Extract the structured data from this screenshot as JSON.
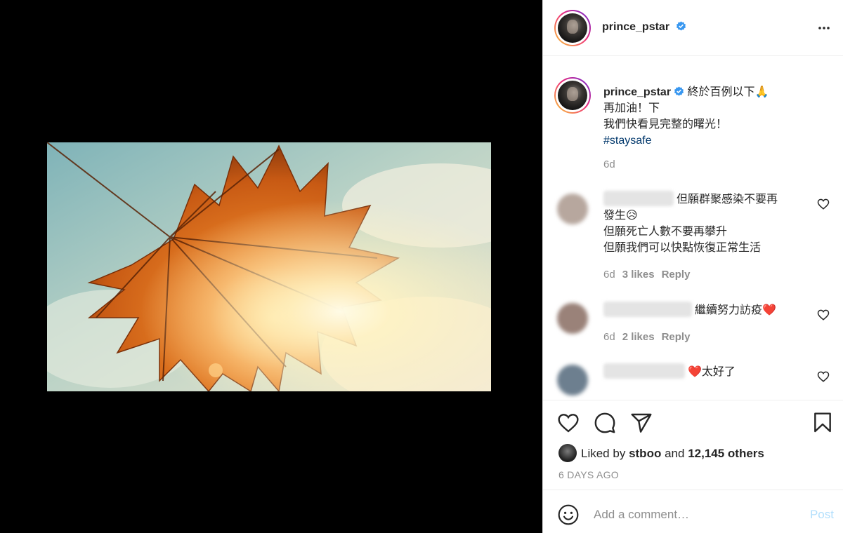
{
  "colors": {
    "accent": "#0095f6",
    "link": "#00376b",
    "muted": "#8e8e8e",
    "text": "#262626",
    "heart": "#ed4956"
  },
  "media": {
    "subject": "maple-leaf-photo"
  },
  "header": {
    "username": "prince_pstar",
    "verified_icon": "verified-badge-icon",
    "more_icon": "more-options-icon"
  },
  "caption": {
    "username": "prince_pstar",
    "line1": "終於百例以下",
    "line1_emoji": "🙏",
    "line2": "再加油！下",
    "line3": "我們快看見完整的曙光！",
    "hashtag": "#staysafe",
    "time": "6d"
  },
  "comments": [
    {
      "text_line1": "但願群聚感染不要再",
      "text_line2": "發生",
      "emoji": "😥",
      "text_line3": "但願死亡人數不要再攀升",
      "text_line4": "但願我們可以快點恢復正常生活",
      "time": "6d",
      "likes": "3 likes",
      "reply": "Reply"
    },
    {
      "text": "繼續努力訪疫",
      "emoji": "❤️",
      "time": "6d",
      "likes": "2 likes",
      "reply": "Reply"
    },
    {
      "emoji": "❤️",
      "text": "太好了"
    }
  ],
  "actions": {
    "icons": [
      "heart-icon",
      "comment-icon",
      "share-icon",
      "bookmark-icon"
    ],
    "liked_prefix": "Liked by",
    "liked_user": "stboo",
    "liked_and": "and",
    "liked_others": "12,145 others",
    "post_time": "6 DAYS AGO"
  },
  "add_comment": {
    "placeholder": "Add a comment…",
    "post_label": "Post",
    "emoji_icon": "emoji-icon"
  }
}
